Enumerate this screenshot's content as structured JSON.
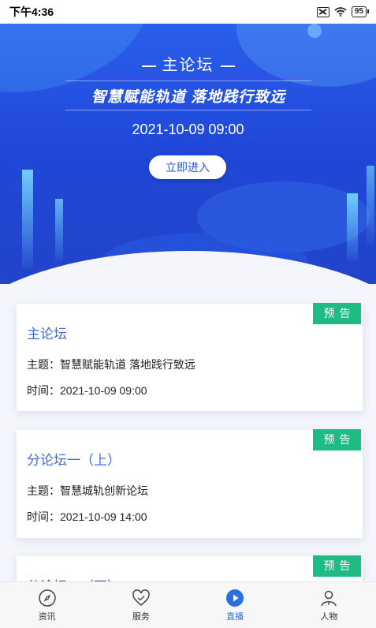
{
  "status_bar": {
    "time": "下午4:36",
    "battery": "95"
  },
  "hero": {
    "title": "主论坛",
    "slogan": "智慧赋能轨道 落地践行致远",
    "datetime": "2021-10-09 09:00",
    "enter_button": "立即进入"
  },
  "cards": [
    {
      "title": "主论坛",
      "badge": "预告",
      "topic": "主题：智慧赋能轨道 落地践行致远",
      "time": "时间：2021-10-09 09:00"
    },
    {
      "title": "分论坛一（上）",
      "badge": "预告",
      "topic": "主题：智慧城轨创新论坛",
      "time": "时间：2021-10-09 14:00"
    },
    {
      "title": "分论坛一（下）",
      "badge": "预告"
    }
  ],
  "tabs": [
    {
      "label": "资讯",
      "icon": "compass-icon"
    },
    {
      "label": "服务",
      "icon": "heart-icon"
    },
    {
      "label": "直播",
      "icon": "play-icon",
      "active": true
    },
    {
      "label": "人物",
      "icon": "person-icon"
    }
  ],
  "colors": {
    "accent": "#2a6fe0",
    "badge": "#1fbb87",
    "card_title": "#3e6fd0"
  }
}
